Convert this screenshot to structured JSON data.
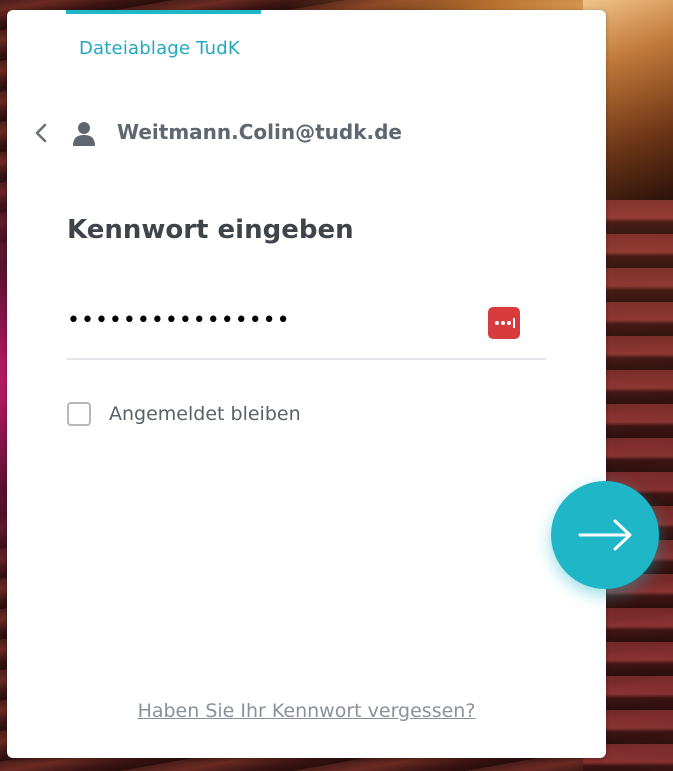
{
  "app": {
    "title": "Dateiablage TudK"
  },
  "account": {
    "email": "Weitmann.Colin@tudk.de",
    "back_icon": "chevron-left-icon",
    "avatar_icon": "user-icon"
  },
  "form": {
    "heading": "Kennwort eingeben",
    "password_mask": "••••••••••••••••",
    "password_manager_icon": "password-manager-icon",
    "remember_label": "Angemeldet bleiben",
    "remember_checked": false,
    "forgot_link": "Haben Sie Ihr Kennwort vergessen?",
    "submit_icon": "arrow-right-icon"
  },
  "colors": {
    "accent": "#1fb6c8",
    "password_manager": "#d83b3b",
    "heading": "#3f434a",
    "muted": "#8a9099"
  }
}
